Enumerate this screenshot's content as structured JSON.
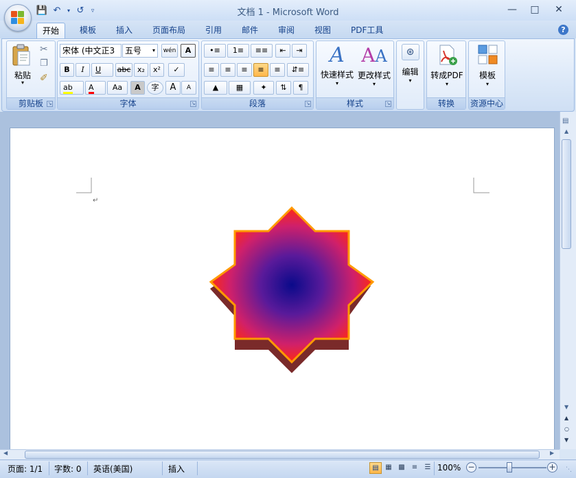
{
  "window": {
    "title": "文档 1 - Microsoft Word"
  },
  "tabs": [
    "开始",
    "模板",
    "插入",
    "页面布局",
    "引用",
    "邮件",
    "审阅",
    "视图",
    "PDF工具"
  ],
  "clipboard": {
    "paste_label": "粘贴",
    "group_label": "剪贴板"
  },
  "font": {
    "family": "宋体 (中文正3",
    "size": "五号",
    "wen_label": "wén",
    "bold": "B",
    "italic": "I",
    "underline": "U",
    "strike": "abc",
    "subscript": "x₂",
    "superscript": "x²",
    "highlight": "ab",
    "font_color": "A",
    "change_case": "Aa",
    "char_shading": "A",
    "enclose": "字",
    "grow": "A",
    "shrink": "A",
    "group_label": "字体"
  },
  "paragraph": {
    "group_label": "段落"
  },
  "styles": {
    "quick_styles": "快速样式",
    "change_styles": "更改样式",
    "group_label": "样式"
  },
  "editing": {
    "label": "编辑"
  },
  "convert": {
    "label": "转成PDF",
    "group_label": "转换"
  },
  "resources": {
    "label": "模板",
    "group_label": "资源中心"
  },
  "status": {
    "page": "页面: 1/1",
    "words": "字数: 0",
    "language": "英语(美国)",
    "mode": "插入",
    "zoom": "100%"
  },
  "colors": {
    "highlight": "#ffff00",
    "font_color": "#ff0000"
  }
}
